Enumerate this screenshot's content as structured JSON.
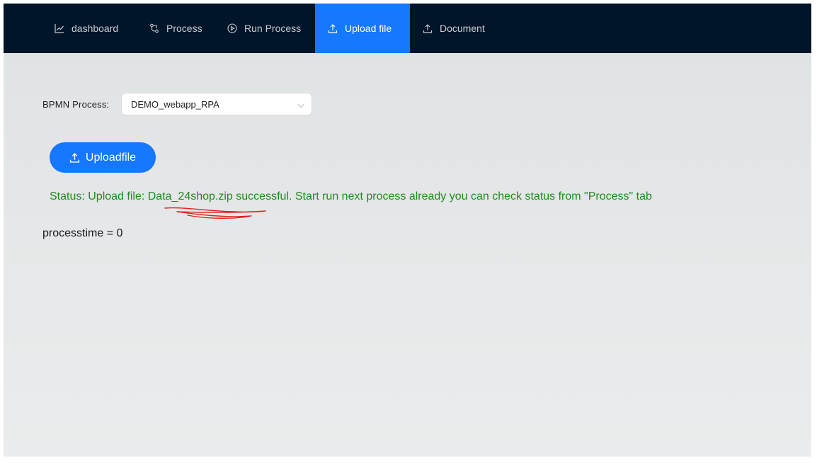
{
  "nav": {
    "items": [
      {
        "label": "dashboard",
        "icon": "line-chart-icon"
      },
      {
        "label": "Process",
        "icon": "branches-icon"
      },
      {
        "label": "Run Process",
        "icon": "play-circle-icon"
      },
      {
        "label": "Upload file",
        "icon": "upload-icon",
        "active": true
      },
      {
        "label": "Document",
        "icon": "upload-icon"
      }
    ]
  },
  "form": {
    "process_label": "BPMN Process:",
    "process_value": "DEMO_webapp_RPA"
  },
  "upload_button": {
    "label": "Uploadfile",
    "icon": "upload-icon"
  },
  "status": {
    "text": "Status: Upload file: Data_24shop.zip successful. Start run next process already you can check status from \"Process\" tab",
    "color": "#1e8c1e"
  },
  "processtime": "processtime = 0",
  "colors": {
    "nav_bg": "#001529",
    "accent": "#1677ff",
    "annotation": "#e02020"
  }
}
